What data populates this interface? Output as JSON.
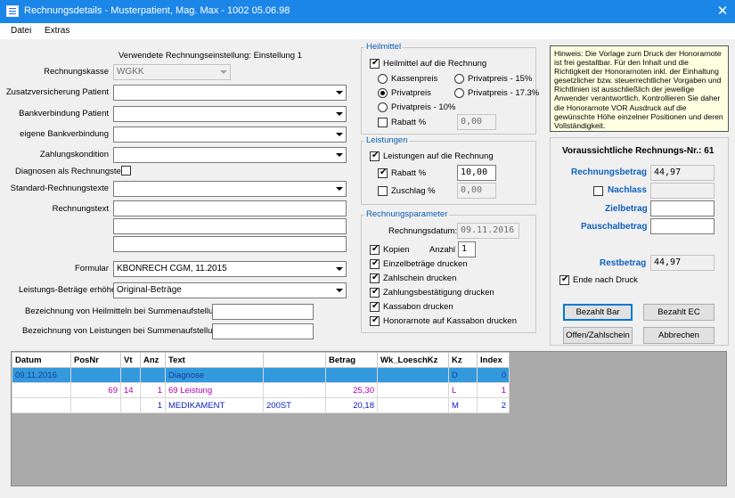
{
  "window": {
    "title": "Rechnungsdetails - Musterpatient, Mag. Max - 1002 05.06.98"
  },
  "menu": [
    "Datei",
    "Extras"
  ],
  "settings": {
    "heading": "Verwendete Rechnungseinstellung: Einstellung 1",
    "rechnungskasse_label": "Rechnungskasse",
    "rechnungskasse_value": "WGKK",
    "zusatz_label": "Zusatzversicherung Patient",
    "bank_patient_label": "Bankverbindung Patient",
    "bank_eigene_label": "eigene Bankverbindung",
    "zahlungskondition_label": "Zahlungskondition",
    "diagnosen_label": "Diagnosen als Rechnungstext",
    "standard_texte_label": "Standard-Rechnungstexte",
    "rechnungstext_label": "Rechnungstext",
    "formular_label": "Formular",
    "formular_value": "KBONRECH CGM, 11.2015",
    "leistungs_label": "Leistungs-Beträge erhöhen",
    "leistungs_value": "Original-Beträge",
    "bez_heilmittel_label": "Bezeichnung von Heilmitteln bei Summenaufstellung",
    "bez_leistungen_label": "Bezeichnung von Leistungen bei Summenaufstellung"
  },
  "heilmittel": {
    "title": "Heilmittel",
    "auf_rechnung": "Heilmittel auf die Rechnung",
    "kassenpreis": "Kassenpreis",
    "privatpreis": "Privatpreis",
    "privatpreis10": "Privatpreis - 10%",
    "privatpreis15": "Privatpreis - 15%",
    "privatpreis173": "Privatpreis - 17.3%",
    "rabatt_label": "Rabatt %",
    "rabatt_value": "0,00"
  },
  "leistungen": {
    "title": "Leistungen",
    "auf_rechnung": "Leistungen auf die Rechnung",
    "rabatt_label": "Rabatt %",
    "rabatt_value": "10,00",
    "zuschlag_label": "Zuschlag %",
    "zuschlag_value": "0,00"
  },
  "parameter": {
    "title": "Rechnungsparameter",
    "datum_label": "Rechnungsdatum:",
    "datum_value": "09.11.2016",
    "kopien_label": "Kopien",
    "anzahl_label": "Anzahl",
    "anzahl_value": "1",
    "einzelbetraege": "Einzelbeträge drucken",
    "zahlschein": "Zahlschein drucken",
    "zahlungsbestaetigung": "Zahlungsbestätigung drucken",
    "kassabon": "Kassabon drucken",
    "honorarnote": "Honorarnote auf Kassabon drucken"
  },
  "hint": "Hinweis: Die Vorlage zum Druck der Honorarnote ist frei gestaltbar. Für den Inhalt und die Richtigkeit der Honorarnoten inkl. der Einhaltung gesetzlicher bzw. steuerrechtlicher Vorgaben und Richtlinien ist ausschließlich der jeweilige Anwender verantwortlich. Kontrollieren Sie daher die Honorarnote VOR Ausdruck auf die gewünschte Höhe einzelner Positionen und deren Vollständigkeit.",
  "summary": {
    "rechnungs_nr": "Voraussichtliche Rechnungs-Nr.: 61",
    "rechnungsbetrag_label": "Rechnungsbetrag",
    "rechnungsbetrag_value": "44,97",
    "nachlass_label": "Nachlass",
    "zielbetrag_label": "Zielbetrag",
    "pauschalbetrag_label": "Pauschalbetrag",
    "restbetrag_label": "Restbetrag",
    "restbetrag_value": "44,97",
    "ende_label": "Ende nach Druck"
  },
  "buttons": {
    "bezahlt_bar": "Bezahlt Bar",
    "bezahlt_ec": "Bezahlt EC",
    "offen": "Offen/Zahlschein",
    "abbrechen": "Abbrechen"
  },
  "table": {
    "headers": [
      "Datum",
      "PosNr",
      "Vt",
      "Anz",
      "Text",
      "",
      "Betrag",
      "Wk_LoeschKz",
      "Kz",
      "Index"
    ],
    "rows": [
      [
        "09.11.2016",
        "",
        "",
        "",
        "Diagnose",
        "",
        "",
        "",
        "D",
        "0"
      ],
      [
        "",
        "69",
        "14",
        "1",
        "69 Leistung",
        "",
        "25,30",
        "",
        "L",
        "1"
      ],
      [
        "",
        "",
        "",
        "1",
        "MEDIKAMENT",
        "200ST",
        "20,18",
        "",
        "M",
        "2"
      ]
    ]
  },
  "colors": {
    "titlebar": "#1c86e8",
    "selection": "#3399dd",
    "label_blue": "#1060c0"
  }
}
